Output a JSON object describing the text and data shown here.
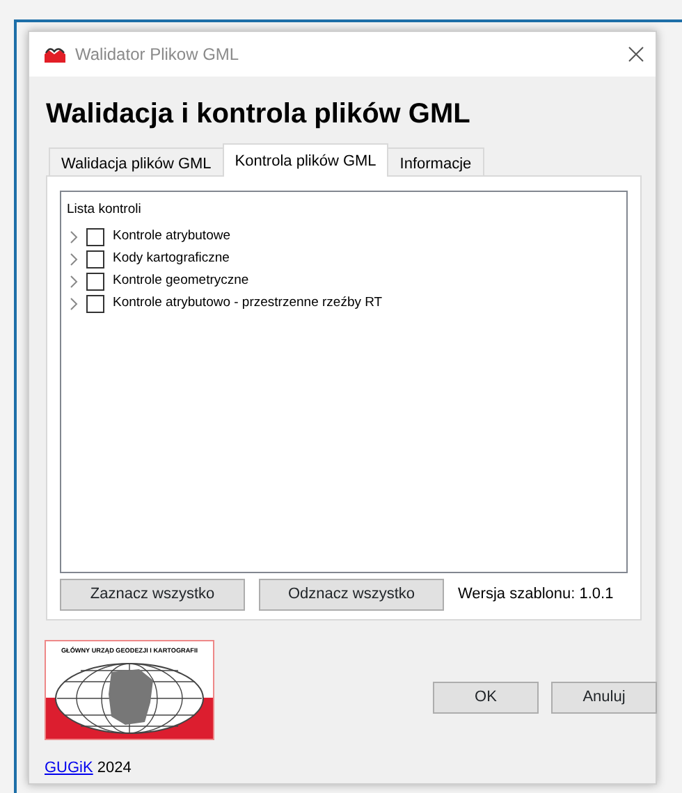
{
  "window": {
    "title": "Walidator Plikow GML"
  },
  "heading": "Walidacja i kontrola plików GML",
  "tabs": [
    {
      "label": "Walidacja plików GML",
      "selected": false
    },
    {
      "label": "Kontrola plików GML",
      "selected": true
    },
    {
      "label": "Informacje",
      "selected": false
    }
  ],
  "tree": {
    "label": "Lista kontroli",
    "items": [
      {
        "label": "Kontrole atrybutowe",
        "checked": false,
        "expanded": false
      },
      {
        "label": "Kody kartograficzne",
        "checked": false,
        "expanded": false
      },
      {
        "label": "Kontrole geometryczne",
        "checked": false,
        "expanded": false
      },
      {
        "label": "Kontrole atrybutowo - przestrzenne rzeźby RT",
        "checked": false,
        "expanded": false
      }
    ]
  },
  "panel_buttons": [
    "Zaznacz wszystko",
    "Odznacz wszystko"
  ],
  "version": "Wersja szablonu: 1.0.1",
  "logo": {
    "caption": "GŁÓWNY URZĄD GEODEZJI I KARTOGRAFII"
  },
  "dialog_buttons": [
    "OK",
    "Anuluj"
  ],
  "footer": {
    "link": "GUGiK",
    "year": "2024"
  }
}
